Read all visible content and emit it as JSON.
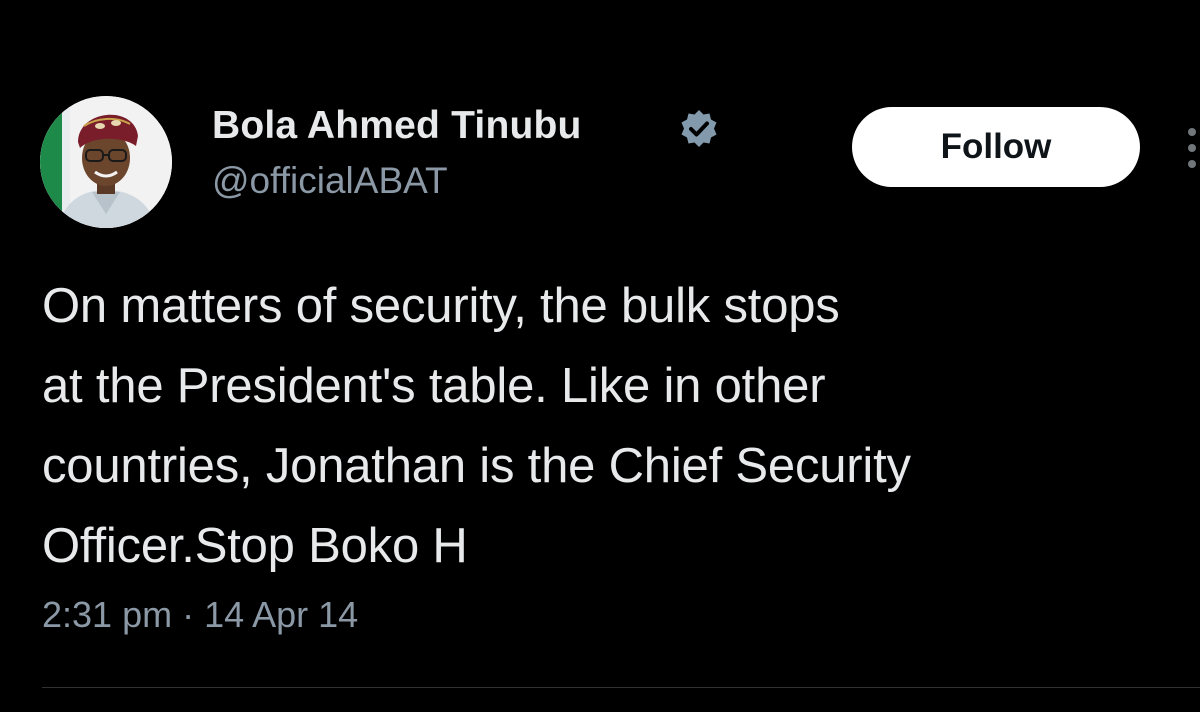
{
  "tweet": {
    "author": {
      "display_name": "Bola Ahmed Tinubu",
      "handle": "@officialABAT",
      "verified": true,
      "avatar": "profile-photo"
    },
    "follow_label": "Follow",
    "text": "On matters of security, the bulk stops\nat the President's table. Like in other\ncountries, Jonathan is the Chief Security\nOfficer.Stop Boko H",
    "timestamp": "2:31 pm · 14 Apr 14"
  },
  "icons": {
    "verified": "verified-badge-icon",
    "more": "more-vertical-icon"
  },
  "colors": {
    "background": "#000000",
    "primary_text": "#e7e9ea",
    "secondary_text": "#8b98a5",
    "follow_bg": "#ffffff",
    "verified_badge": "#829aab"
  }
}
